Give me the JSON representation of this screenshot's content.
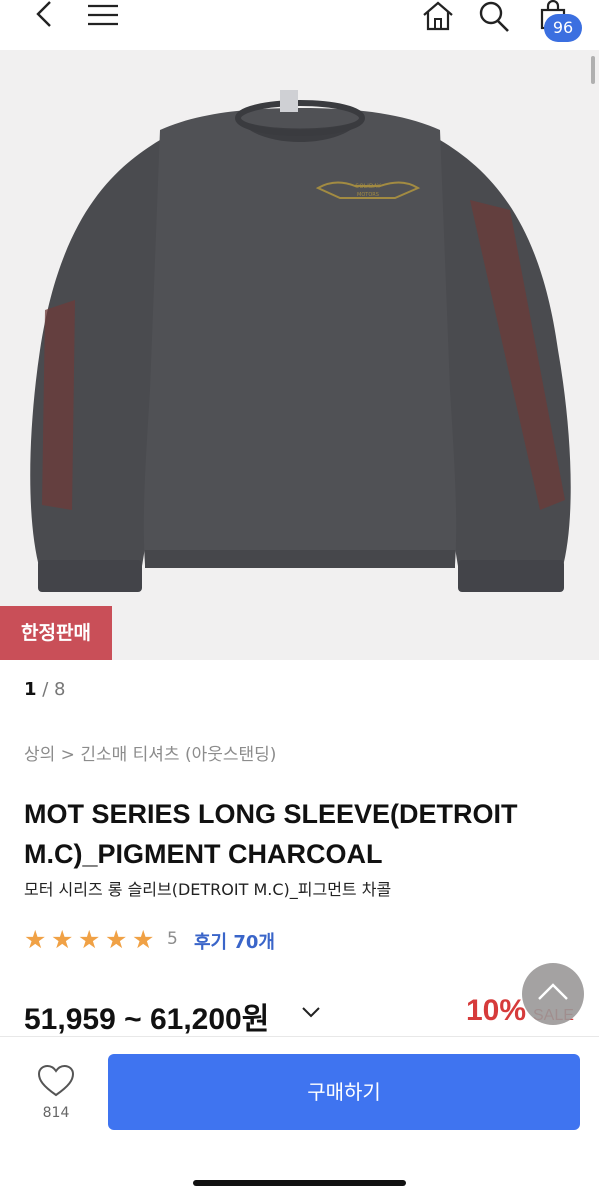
{
  "cart": {
    "count": "96"
  },
  "product": {
    "limited_badge": "한정판매",
    "image_index": "1",
    "image_total": "/ 8",
    "breadcrumb": "상의 > 긴소매 티셔츠 (아웃스탠딩)",
    "title": "MOT SERIES LONG SLEEVE(DETROIT M.C)_PIGMENT CHARCOAL",
    "subtitle": "모터 시리즈 롱 슬리브(DETROIT M.C)_피그먼트 차콜",
    "rating_value": "5",
    "stars": 5,
    "reviews": "후기 70개",
    "price": "51,959 ~ 61,200원",
    "discount": "10%",
    "sale_label": "SALE",
    "logo_text": [
      "SOLIDAY",
      "MOTORS"
    ]
  },
  "bottom": {
    "like_count": "814",
    "buy_label": "구매하기"
  },
  "icons": {
    "back": "back-icon",
    "menu": "menu-icon",
    "home": "home-icon",
    "search": "search-icon",
    "cart": "cart-icon",
    "heart": "heart-icon",
    "scroll_top": "chevron-up-icon",
    "dropdown": "chevron-down-icon"
  },
  "colors": {
    "accent_blue": "#3f74f0",
    "badge_red": "#c94f58",
    "sale_red": "#d63b3b",
    "star": "#f0a145",
    "review_link": "#3a65c9"
  }
}
